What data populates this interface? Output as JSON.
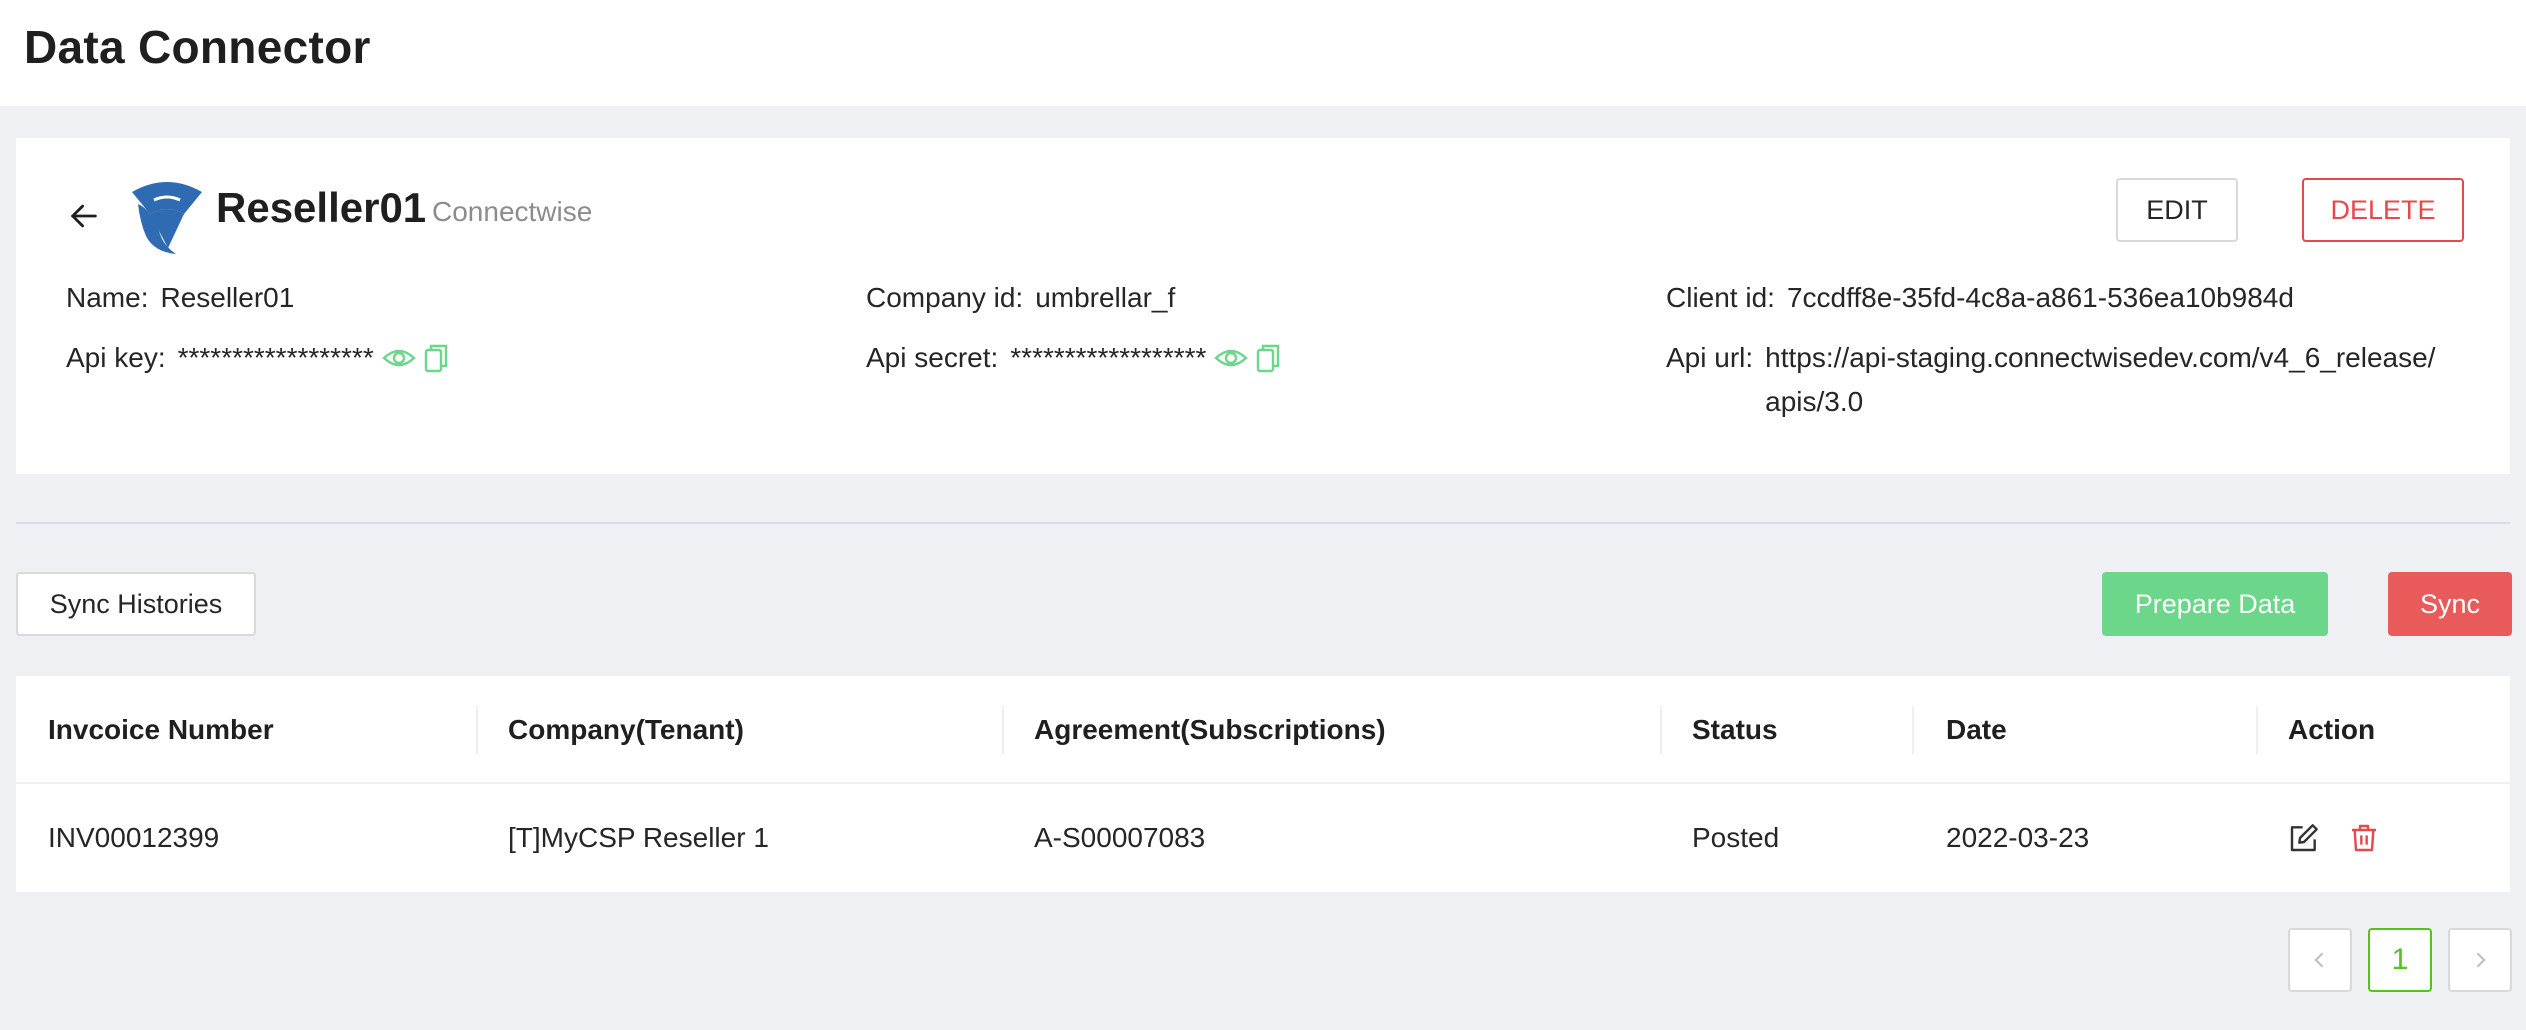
{
  "page": {
    "title": "Data Connector"
  },
  "connector": {
    "name": "Reseller01",
    "type": "Connectwise",
    "edit_label": "EDIT",
    "delete_label": "DELETE",
    "fields": {
      "name_label": "Name:",
      "name_value": "Reseller01",
      "company_id_label": "Company id:",
      "company_id_value": "umbrellar_f",
      "client_id_label": "Client id:",
      "client_id_value": "7ccdff8e-35fd-4c8a-a861-536ea10b984d",
      "api_key_label": "Api key:",
      "api_key_value": "******************",
      "api_secret_label": "Api secret:",
      "api_secret_value": "******************",
      "api_url_label": "Api url:",
      "api_url_value": "https://api-staging.connectwisedev.com/v4_6_release/apis/3.0"
    }
  },
  "toolbar": {
    "sync_histories_label": "Sync Histories",
    "prepare_data_label": "Prepare Data",
    "sync_label": "Sync"
  },
  "table": {
    "headers": [
      "Invcoice Number",
      "Company(Tenant)",
      "Agreement(Subscriptions)",
      "Status",
      "Date",
      "Action"
    ],
    "rows": [
      {
        "invoice": "INV00012399",
        "company": "[T]MyCSP Reseller 1",
        "agreement": "A-S00007083",
        "status": "Posted",
        "date": "2022-03-23"
      }
    ]
  },
  "pagination": {
    "current_page": "1"
  },
  "icons": {
    "back": "arrow-left-icon",
    "logo": "connectwise-logo",
    "reveal": "eye-icon",
    "copy": "copy-icon",
    "edit": "edit-icon",
    "delete": "trash-icon",
    "prev": "chevron-left-icon",
    "next": "chevron-right-icon"
  },
  "colors": {
    "accent_green": "#6cd68a",
    "danger_red": "#e95b5b",
    "logo_blue": "#2f6bb3",
    "background": "#eff0f4"
  }
}
